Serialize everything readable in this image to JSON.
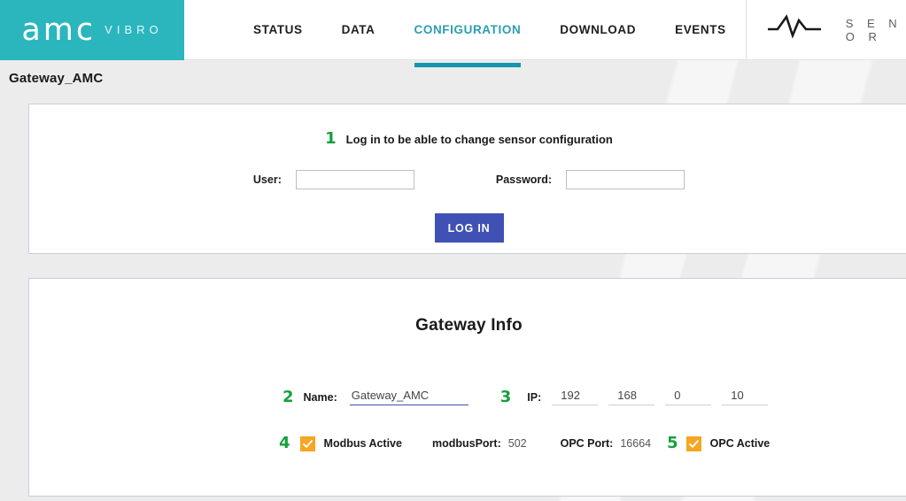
{
  "header": {
    "logo": {
      "brand": "amc",
      "sub": "VIBRO",
      "bg_color": "#2bb6bd"
    },
    "nav": [
      {
        "label": "STATUS",
        "active": false
      },
      {
        "label": "DATA",
        "active": false
      },
      {
        "label": "CONFIGURATION",
        "active": true
      },
      {
        "label": "DOWNLOAD",
        "active": false
      },
      {
        "label": "EVENTS",
        "active": false
      }
    ],
    "active_nav_color": "#2b9fb0",
    "sensor_logo": {
      "icon": "waveform-icon",
      "word": "S E N S O R"
    }
  },
  "page_title": "Gateway_AMC",
  "login_panel": {
    "marker": "1",
    "headline": "Log in to be able to change sensor configuration",
    "user_label": "User:",
    "user_value": "",
    "user_placeholder": "",
    "password_label": "Password:",
    "password_value": "",
    "password_placeholder": "",
    "login_button": "LOG IN",
    "login_button_color": "#3f51b5"
  },
  "gateway_panel": {
    "title": "Gateway Info",
    "name_marker": "2",
    "name_label": "Name:",
    "name_value": "Gateway_AMC",
    "ip_marker": "3",
    "ip_label": "IP:",
    "ip_octets": [
      "192",
      "168",
      "0",
      "10"
    ],
    "modbus_marker": "4",
    "modbus_checked": true,
    "modbus_label": "Modbus Active",
    "modbus_port_label": "modbusPort:",
    "modbus_port_value": "502",
    "opc_port_label": "OPC Port:",
    "opc_port_value": "16664",
    "opc_marker": "5",
    "opc_checked": true,
    "opc_label": "OPC Active",
    "checkbox_color": "#f5a623",
    "marker_color": "#15a03c"
  }
}
